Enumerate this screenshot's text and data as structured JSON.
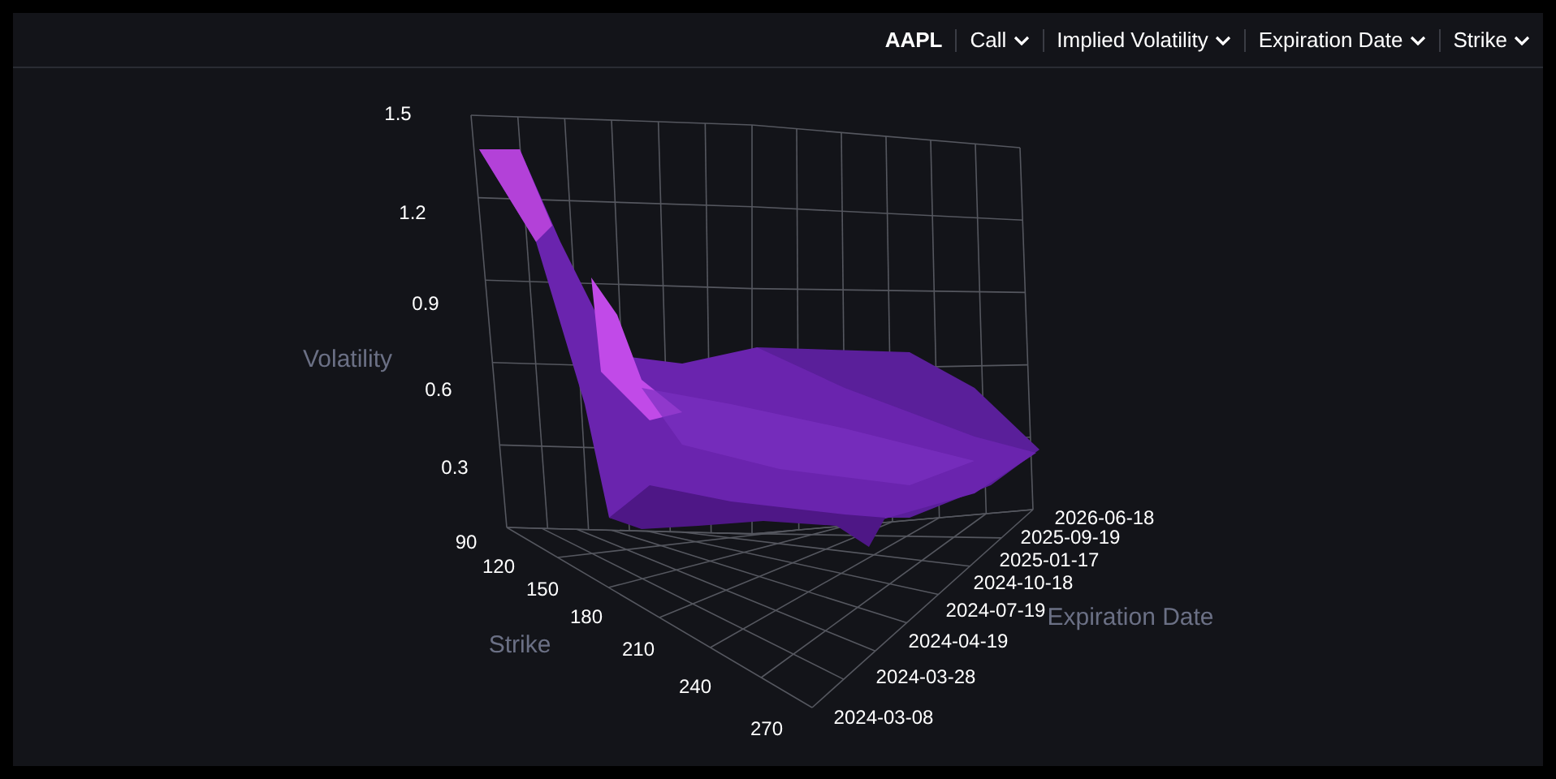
{
  "toolbar": [
    {
      "kind": "label",
      "text": "AAPL"
    },
    {
      "kind": "dropdown",
      "text": "Call"
    },
    {
      "kind": "dropdown",
      "text": "Implied Volatility"
    },
    {
      "kind": "dropdown",
      "text": "Expiration Date"
    },
    {
      "kind": "dropdown",
      "text": "Strike"
    }
  ],
  "surface_plot": {
    "z_axis": {
      "title": "Volatility",
      "ticks": [
        "1.5",
        "1.2",
        "0.9",
        "0.6",
        "0.3"
      ]
    },
    "x_axis": {
      "title": "Strike",
      "ticks": [
        "90",
        "120",
        "150",
        "180",
        "210",
        "240",
        "270"
      ]
    },
    "y_axis": {
      "title": "Expiration Date",
      "ticks": [
        "2026-06-18",
        "2025-09-19",
        "2025-01-17",
        "2024-10-18",
        "2024-07-19",
        "2024-04-19",
        "2024-03-28",
        "2024-03-08"
      ]
    }
  }
}
